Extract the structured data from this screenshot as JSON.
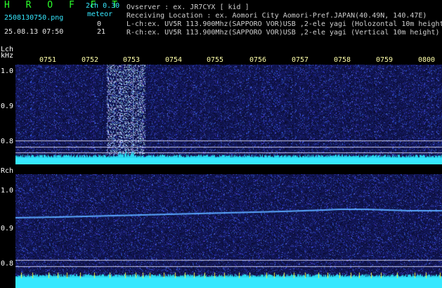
{
  "header": {
    "app_title": "H R O F F T",
    "version": "2ch 0.30",
    "meteor_label": "meteor",
    "filename": "2508130750.png",
    "datetime": "25.08.13 07:50",
    "lch_count": "0",
    "rch_count": "21",
    "observer": "Ovserver          : ex. JR7CYX [ kid ]",
    "location": "Receiving Location : ex. Aomori City Aomori-Pref.JAPAN(40.49N, 140.47E)",
    "lch_info": "L-ch:ex. UV5R 113.900Mhz(SAPPORO VOR)USB ,2-ele yagi (Holozontal 10m height)",
    "rch_info": "R-ch:ex. UV5R 113.900Mhz(SAPPORO VOR)USB ,2-ele yagi (Vertical 10m height)"
  },
  "lch": {
    "label_line1": "Lch",
    "label_line2": "kHz",
    "freq_labels": [
      "1.0",
      "0.9",
      "0.8"
    ]
  },
  "rch": {
    "label": "Rch",
    "freq_labels": [
      "1.0",
      "0.9",
      "0.8"
    ]
  },
  "time_axis": [
    "0751",
    "0752",
    "0753",
    "0754",
    "0755",
    "0756",
    "0757",
    "0758",
    "0759",
    "0800"
  ],
  "colors": {
    "background": "#000000",
    "waterfall_base": "#0a0a4a",
    "noise_blue": "#3a4cff",
    "signal_trace": "#5aa8ff",
    "level_bar": "#36e8ff",
    "title_green": "#2cff2c",
    "tick_yellow": "#ffffaa",
    "header_cyan": "#36e8ff"
  }
}
